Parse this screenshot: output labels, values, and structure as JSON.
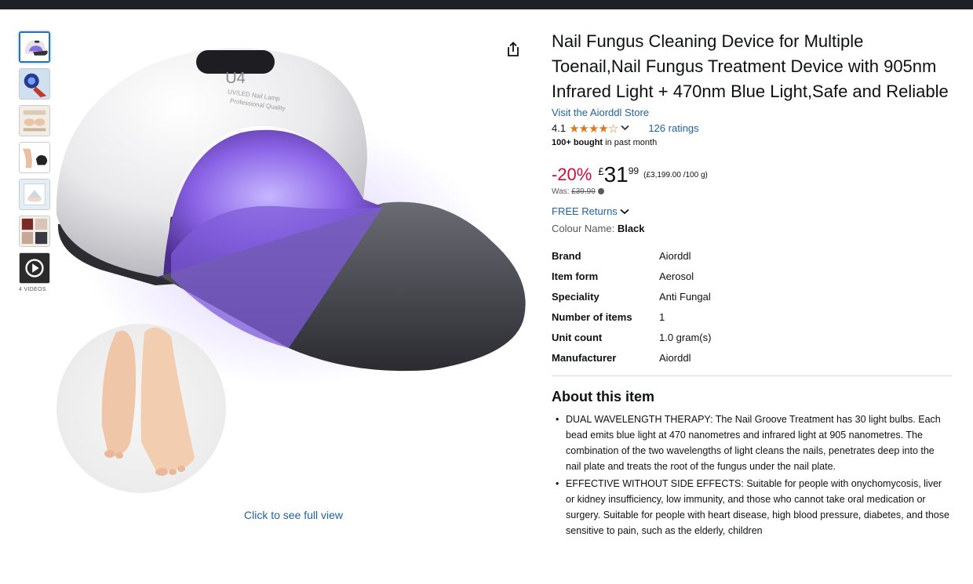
{
  "icons": {
    "share": "share-icon",
    "video": "play-icon",
    "chevron": "chevron-down-icon",
    "info": "info-icon"
  },
  "colors": {
    "link": "#2162a1",
    "discount": "#cc0c39",
    "stars": "#de7921",
    "topbar": "#1e2028"
  },
  "gallery": {
    "video_label": "4 VIDEOS",
    "full_view_link": "Click to see full view",
    "thumbnails": [
      "thumb-1",
      "thumb-2",
      "thumb-3",
      "thumb-4",
      "thumb-5",
      "thumb-6",
      "video-thumb"
    ],
    "product_lettering": [
      "U4",
      "UV/LED Nail Lamp",
      "Professional Quality"
    ]
  },
  "product": {
    "title": "Nail Fungus Cleaning Device for Multiple Toenail,Nail Fungus Treatment Device with 905nm Infrared Light + 470nm Blue Light,Safe and Reliable",
    "store_link": "Visit the Aiorddl Store",
    "rating": "4.1",
    "stars": "★★★★☆",
    "ratings_count": "126 ratings",
    "bought_bold": "100+ bought",
    "bought_rest": " in past month"
  },
  "price": {
    "discount": "-20%",
    "currency": "£",
    "whole": "31",
    "fraction": "99",
    "unit_price": "(£3,199.00 /100 g)",
    "was_label": "Was: ",
    "was_price": "£39.99"
  },
  "delivery": {
    "returns": "FREE Returns"
  },
  "colour": {
    "label": "Colour Name: ",
    "value": "Black"
  },
  "specs": [
    {
      "key": "Brand",
      "value": "Aiorddl"
    },
    {
      "key": "Item form",
      "value": "Aerosol"
    },
    {
      "key": "Speciality",
      "value": "Anti Fungal"
    },
    {
      "key": "Number of items",
      "value": "1"
    },
    {
      "key": "Unit count",
      "value": "1.0 gram(s)"
    },
    {
      "key": "Manufacturer",
      "value": "Aiorddl"
    }
  ],
  "about": {
    "heading": "About this item",
    "bullets": [
      "DUAL WAVELENGTH THERAPY: The Nail Groove Treatment has 30 light bulbs. Each bead emits blue light at 470 nanometres and infrared light at 905 nanometres. The combination of the two wavelengths of light cleans the nails, penetrates deep into the nail plate and treats the root of the fungus under the nail plate.",
      "EFFECTIVE WITHOUT SIDE EFFECTS: Suitable for people with onychomycosis, liver or kidney insufficiency, low immunity, and those who cannot take oral medication or surgery. Suitable for people with heart disease, high blood pressure, diabetes, and those sensitive to pain, such as the elderly, children"
    ]
  }
}
